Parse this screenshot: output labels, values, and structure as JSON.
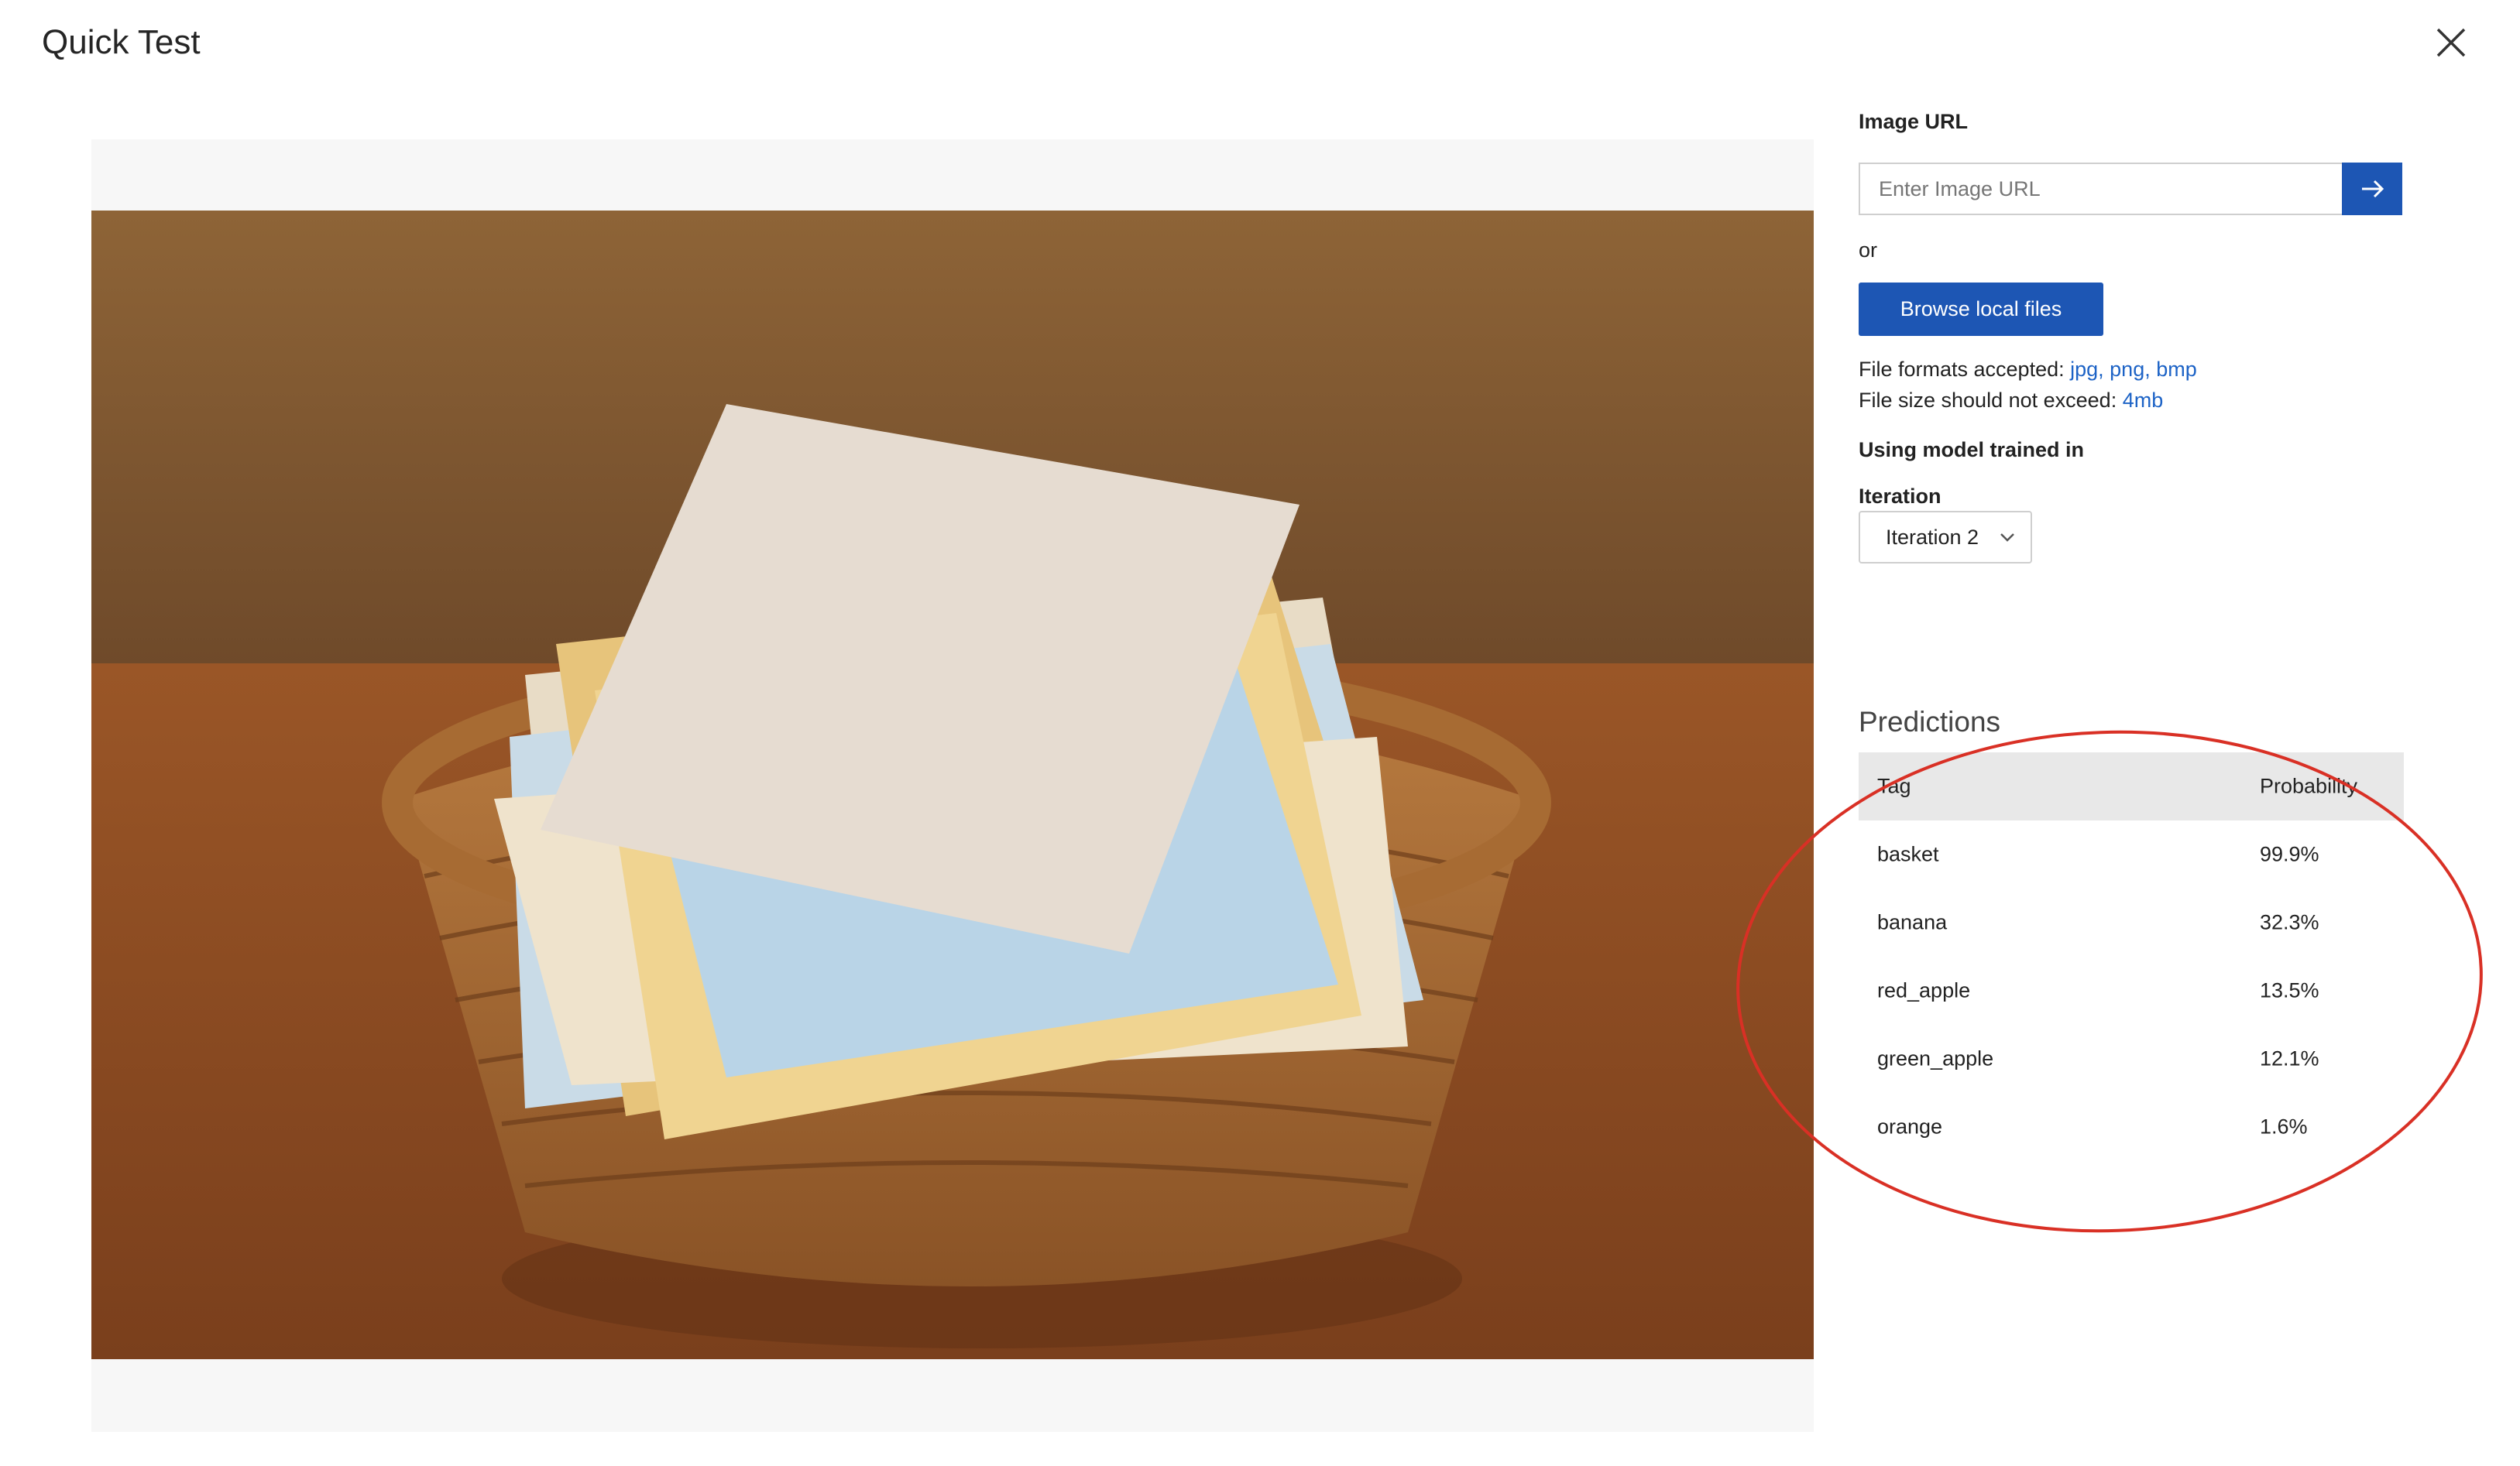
{
  "window": {
    "title": "Quick Test"
  },
  "image_panel": {
    "description_icon": "basket-with-paper-stack"
  },
  "upload": {
    "image_url_label": "Image URL",
    "image_url_placeholder": "Enter Image URL",
    "or_text": "or",
    "browse_label": "Browse local files",
    "formats_prefix": "File formats accepted: ",
    "formats_value": "jpg, png, bmp",
    "size_prefix": "File size should not exceed: ",
    "size_value": "4mb"
  },
  "model": {
    "heading": "Using model trained in",
    "iteration_label": "Iteration",
    "iteration_selected": "Iteration 2"
  },
  "predictions": {
    "title": "Predictions",
    "columns": {
      "tag": "Tag",
      "probability": "Probability"
    },
    "rows": [
      {
        "tag": "basket",
        "probability": "99.9%"
      },
      {
        "tag": "banana",
        "probability": "32.3%"
      },
      {
        "tag": "red_apple",
        "probability": "13.5%"
      },
      {
        "tag": "green_apple",
        "probability": "12.1%"
      },
      {
        "tag": "orange",
        "probability": "1.6%"
      }
    ]
  },
  "colors": {
    "accent": "#1d56b4",
    "link": "#1d63c6",
    "annotation": "#d93025"
  }
}
